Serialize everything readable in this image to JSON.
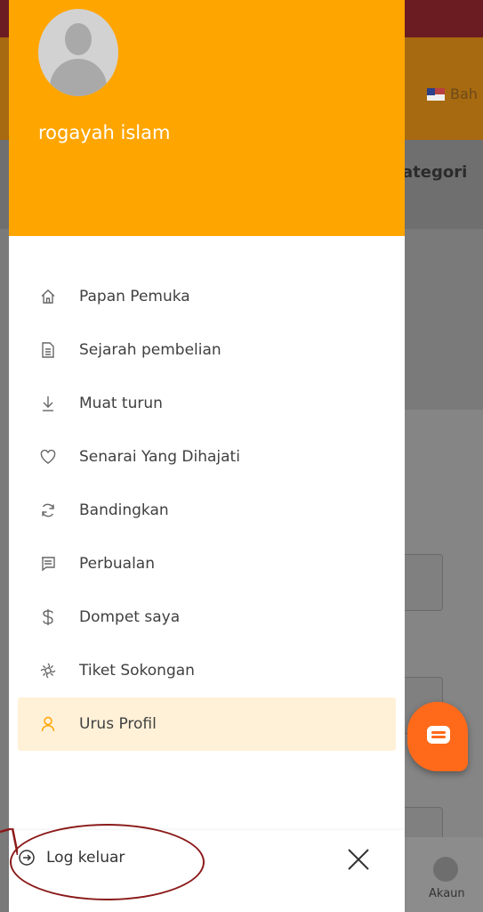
{
  "user": {
    "name": "rogayah islam"
  },
  "background": {
    "language_label": "Bah",
    "category_label": "ategori",
    "account_label": "Akaun"
  },
  "menu": {
    "items": [
      {
        "label": "Papan Pemuka",
        "icon": "home-icon"
      },
      {
        "label": "Sejarah pembelian",
        "icon": "document-icon"
      },
      {
        "label": "Muat turun",
        "icon": "download-icon"
      },
      {
        "label": "Senarai Yang Dihajati",
        "icon": "heart-icon"
      },
      {
        "label": "Bandingkan",
        "icon": "refresh-icon"
      },
      {
        "label": "Perbualan",
        "icon": "chat-icon"
      },
      {
        "label": "Dompet saya",
        "icon": "dollar-icon"
      },
      {
        "label": "Tiket Sokongan",
        "icon": "support-icon"
      },
      {
        "label": "Urus Profil",
        "icon": "user-icon",
        "active": true
      }
    ]
  },
  "footer": {
    "logout_label": "Log keluar"
  },
  "colors": {
    "accent": "#ffa500",
    "active_bg": "#fff1d8",
    "fab": "#ff6a1a",
    "annotation": "#8b1a1a"
  }
}
